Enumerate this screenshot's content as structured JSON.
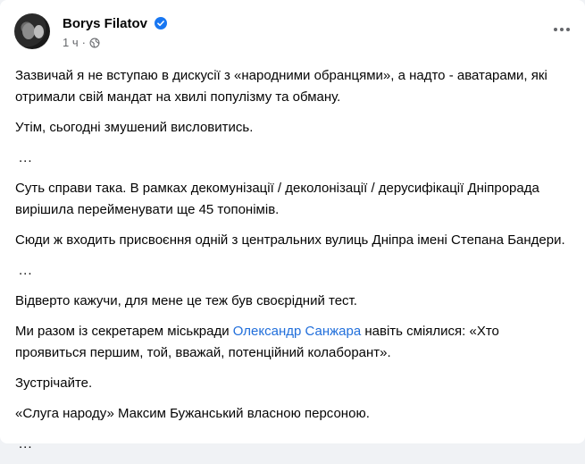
{
  "post": {
    "author": "Borys Filatov",
    "time": "1 ч",
    "separator": "·",
    "paragraphs": [
      {
        "text": "Зазвичай я не вступаю в дискусії з «народними обранцями», а надто - аватарами, які отримали свій мандат на хвилі популізму та обману."
      },
      {
        "text": "Утім, сьогодні змушений висловитись."
      },
      {
        "text": "..."
      },
      {
        "text": "Суть справи така. В рамках декомунізації / деколонізації / дерусифікації Дніпрорада вирішила перейменувати ще 45 топонімів."
      },
      {
        "text": "Сюди ж входить присвоєння одній з центральних вулиць Дніпра імені Степана Бандери."
      },
      {
        "text": "..."
      },
      {
        "text": "Відверто кажучи, для мене це теж був своєрідний тест."
      },
      {
        "before": "Ми разом із секретарем міськради ",
        "mention": "Олександр Санжара",
        "after": " навіть сміялися: «Хто проявиться першим, той, вважай, потенційний колаборант»."
      },
      {
        "text": "Зустрічайте."
      },
      {
        "text": "«Слуга народу» Максим Бужанський власною персоною."
      },
      {
        "text": "..."
      }
    ]
  },
  "icons": {
    "verified": "verified-badge-icon",
    "audience": "globe-icon",
    "more": "more-options-icon"
  },
  "colors": {
    "link": "#216fdb",
    "verified": "#1877f2",
    "secondary_text": "#65676b"
  }
}
